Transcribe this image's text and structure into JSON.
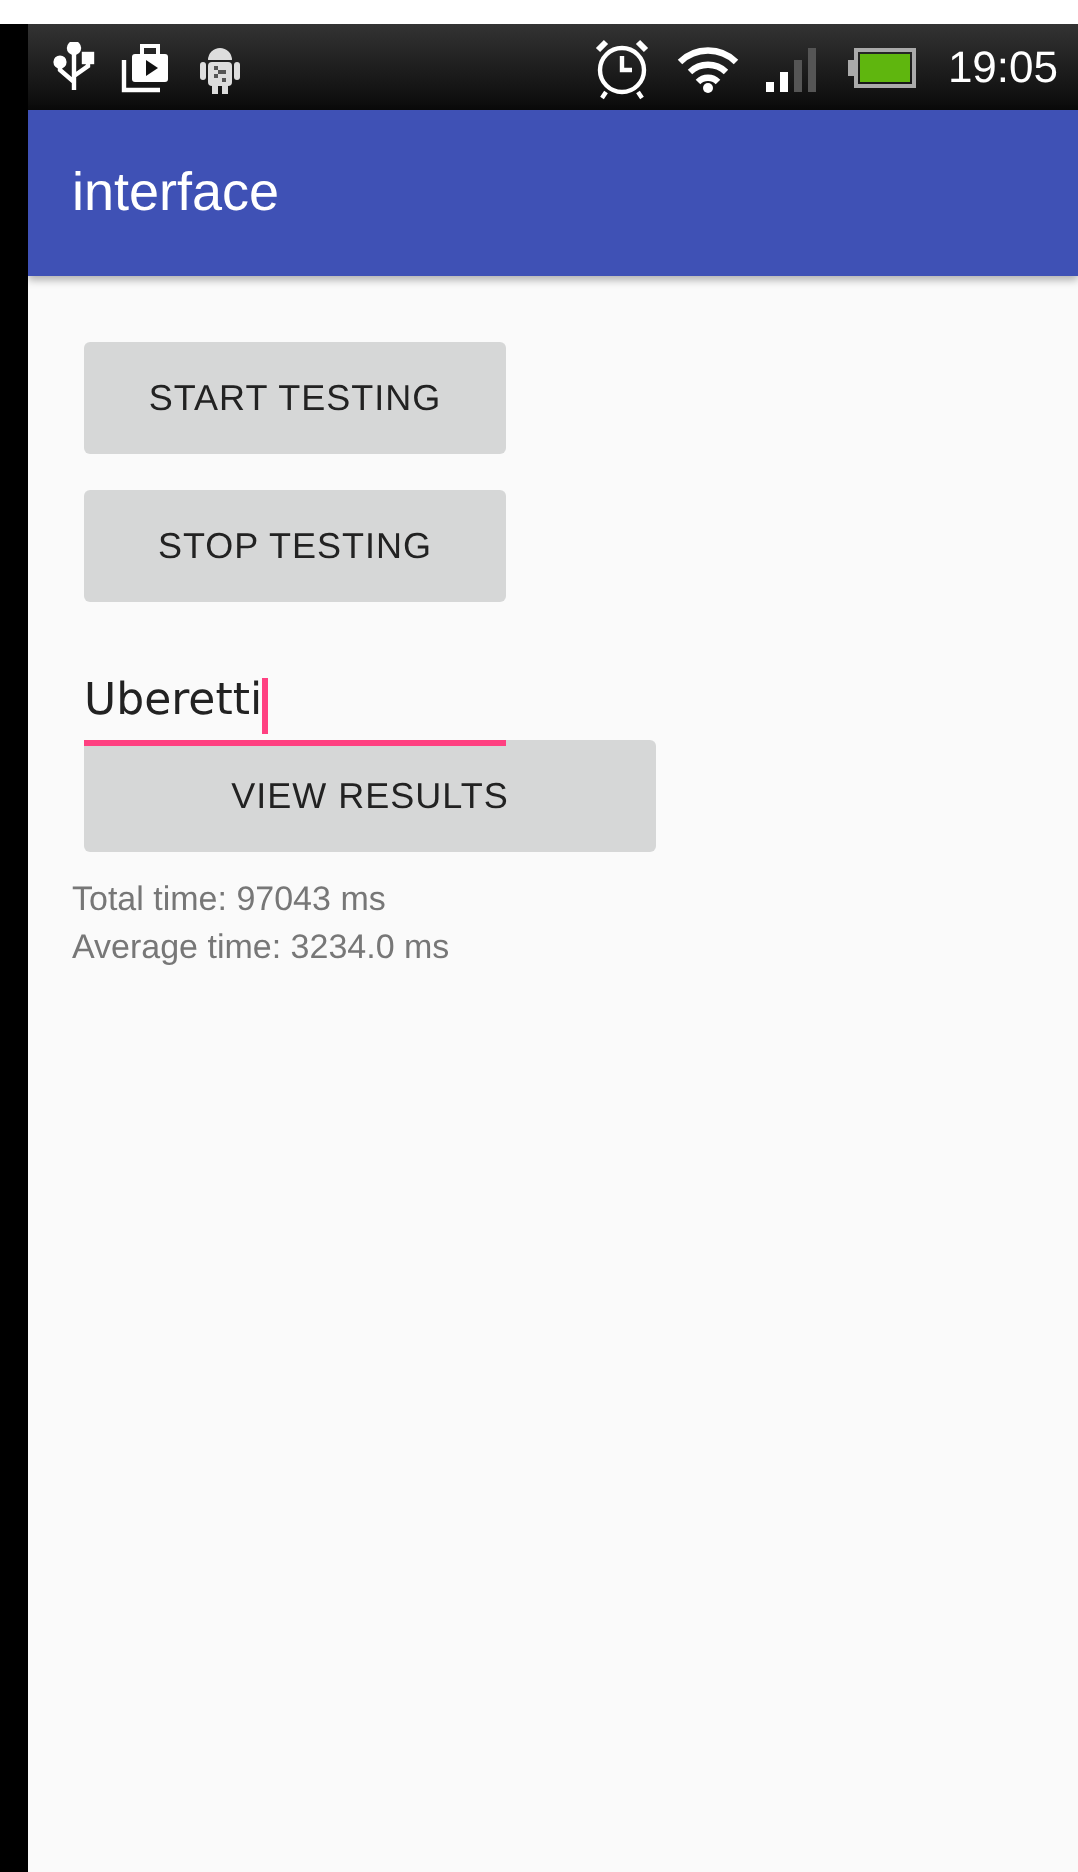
{
  "status_bar": {
    "time": "19:05"
  },
  "app_bar": {
    "title": "interface"
  },
  "buttons": [
    {
      "label": "START TESTING"
    },
    {
      "label": "STOP TESTING"
    }
  ],
  "name_field": {
    "value": "Uberetti",
    "focused": true
  },
  "results_button": {
    "label": "VIEW RESULTS"
  },
  "results": [
    "Total time: 97043 ms",
    "Average time: 3234.0 ms"
  ]
}
